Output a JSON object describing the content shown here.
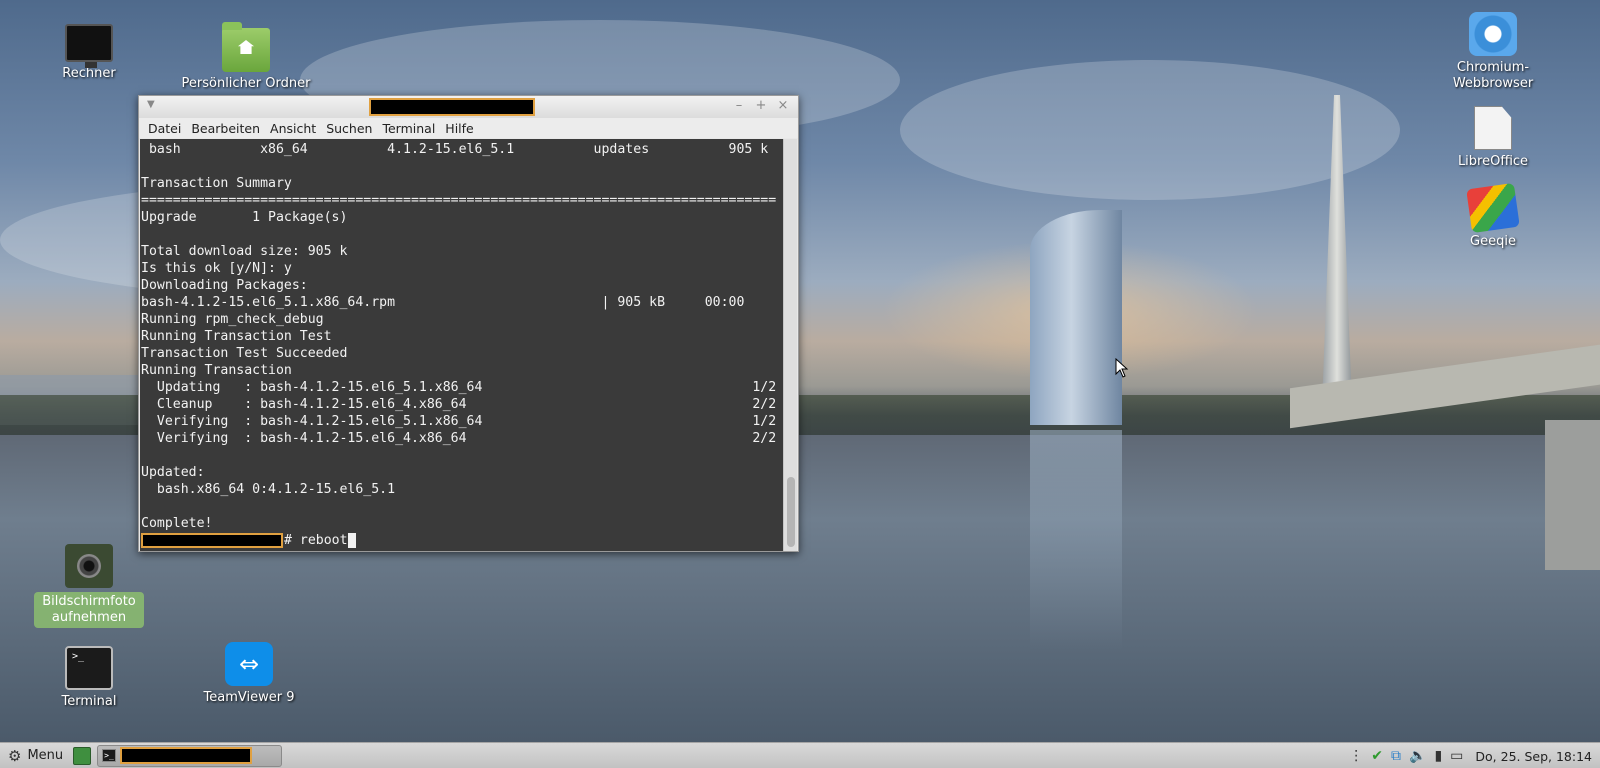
{
  "desktop": {
    "icons": {
      "rechner": "Rechner",
      "home_folder": "Persönlicher Ordner",
      "chromium": "Chromium-Webbrowser",
      "libreoffice": "LibreOffice",
      "geeqie": "Geeqie",
      "screenshot": "Bildschirmfoto aufnehmen",
      "terminal": "Terminal",
      "teamviewer": "TeamViewer 9"
    }
  },
  "terminal_window": {
    "menu": [
      "Datei",
      "Bearbeiten",
      "Ansicht",
      "Suchen",
      "Terminal",
      "Hilfe"
    ],
    "window_buttons": {
      "minimize": "–",
      "maximize": "+",
      "close": "×"
    },
    "lines": [
      " bash          x86_64          4.1.2-15.el6_5.1          updates          905 k",
      "",
      "Transaction Summary",
      "================================================================================",
      "Upgrade       1 Package(s)",
      "",
      "Total download size: 905 k",
      "Is this ok [y/N]: y",
      "Downloading Packages:",
      "bash-4.1.2-15.el6_5.1.x86_64.rpm                          | 905 kB     00:00",
      "Running rpm_check_debug",
      "Running Transaction Test",
      "Transaction Test Succeeded",
      "Running Transaction",
      "  Updating   : bash-4.1.2-15.el6_5.1.x86_64                                  1/2",
      "  Cleanup    : bash-4.1.2-15.el6_4.x86_64                                    2/2",
      "  Verifying  : bash-4.1.2-15.el6_5.1.x86_64                                  1/2",
      "  Verifying  : bash-4.1.2-15.el6_4.x86_64                                    2/2",
      "",
      "Updated:",
      "  bash.x86_64 0:4.1.2-15.el6_5.1",
      "",
      "Complete!"
    ],
    "prompt_command": "# reboot"
  },
  "taskbar": {
    "menu_label": "Menu",
    "clock": "Do, 25. Sep, 18:14"
  },
  "icons": {
    "menu": "gear-icon",
    "show_desktop": "show-desktop-icon",
    "tray": [
      "shield-check-icon",
      "network-icon",
      "volume-icon",
      "signal-icon",
      "battery-icon"
    ]
  }
}
